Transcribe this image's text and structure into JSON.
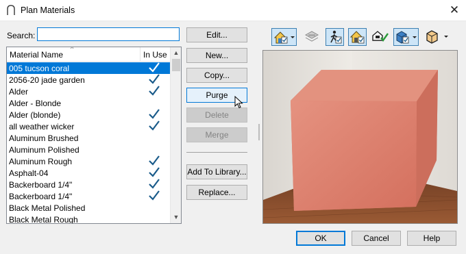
{
  "window": {
    "title": "Plan Materials",
    "close_glyph": "✕"
  },
  "search": {
    "label": "Search:",
    "value": "",
    "placeholder": ""
  },
  "list": {
    "columns": {
      "name": "Material Name",
      "in_use": "In Use"
    },
    "sort_glyph": "^",
    "items": [
      {
        "name": "005 tucson coral",
        "in_use": true,
        "selected": true
      },
      {
        "name": "2056-20 jade garden",
        "in_use": true
      },
      {
        "name": "Alder",
        "in_use": true
      },
      {
        "name": "Alder - Blonde",
        "in_use": false
      },
      {
        "name": "Alder (blonde)",
        "in_use": true
      },
      {
        "name": "all weather wicker",
        "in_use": true
      },
      {
        "name": "Aluminum Brushed",
        "in_use": false
      },
      {
        "name": "Aluminum Polished",
        "in_use": false
      },
      {
        "name": "Aluminum Rough",
        "in_use": true
      },
      {
        "name": "Asphalt-04",
        "in_use": true
      },
      {
        "name": "Backerboard 1/4\"",
        "in_use": true
      },
      {
        "name": "Backerboard 1/4\"",
        "in_use": true
      },
      {
        "name": "Black Metal Polished",
        "in_use": false
      },
      {
        "name": "Black Metal Rough",
        "in_use": false
      }
    ],
    "scroll_up_glyph": "▲",
    "scroll_down_glyph": "▼"
  },
  "buttons": {
    "edit": "Edit...",
    "new": "New...",
    "copy": "Copy...",
    "purge": "Purge",
    "delete": "Delete",
    "merge": "Merge",
    "add_to_library": "Add To Library...",
    "replace": "Replace...",
    "ok": "OK",
    "cancel": "Cancel",
    "help": "Help"
  },
  "toolbar": {
    "icons": [
      "house-view-icon",
      "layer-stack-icon",
      "walkthrough-person-icon",
      "house-check-icon",
      "material-check-icon",
      "cube-check-icon",
      "box-view-icon"
    ]
  },
  "colors": {
    "accent": "#0078d7",
    "check": "#1a5b8a",
    "cube": "#d97a6a",
    "floor": "#8b4a2a",
    "wall": "#e6e2dc"
  }
}
